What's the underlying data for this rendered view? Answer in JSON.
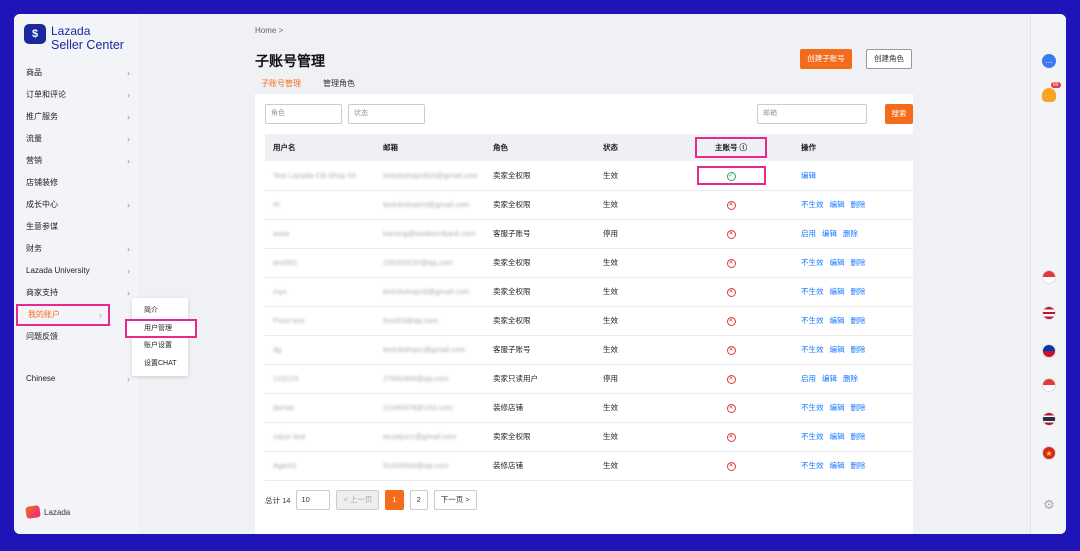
{
  "brand": {
    "name1": "Lazada",
    "name2": "Seller Center",
    "footer": "Lazada"
  },
  "sidebar": {
    "items": [
      {
        "label": "商品",
        "chev": "›"
      },
      {
        "label": "订单和评论",
        "chev": "›"
      },
      {
        "label": "推广服务",
        "chev": "›"
      },
      {
        "label": "流量",
        "chev": "›"
      },
      {
        "label": "营销",
        "chev": "›"
      },
      {
        "label": "店铺装修",
        "chev": ""
      },
      {
        "label": "成长中心",
        "chev": "›"
      },
      {
        "label": "生意参谋",
        "chev": ""
      },
      {
        "label": "财务",
        "chev": "›"
      },
      {
        "label": "Lazada University",
        "chev": "›"
      },
      {
        "label": "商家支持",
        "chev": "›"
      },
      {
        "label": "我的账户",
        "chev": "›"
      },
      {
        "label": "问题反馈",
        "chev": ""
      },
      {
        "label": "Chinese",
        "chev": "›"
      }
    ],
    "submenu": [
      "简介",
      "用户管理",
      "账户设置",
      "设置CHAT"
    ]
  },
  "header": {
    "breadcrumb": "Home  >",
    "title": "子账号管理",
    "create_sub_account": "创建子账号",
    "create_role": "创建角色"
  },
  "tabs": [
    "子账号管理",
    "管理角色"
  ],
  "filters": {
    "role_placeholder": "角色",
    "status_placeholder": "状态",
    "email_placeholder": "邮箱",
    "search": "搜索"
  },
  "table": {
    "headers": [
      "用户名",
      "邮箱",
      "角色",
      "状态",
      "主账号 ⓘ",
      "操作"
    ],
    "rows": [
      {
        "name": "Test Lazada CB Shop 03",
        "email": "testcbshop1803@gmail.com",
        "role": "卖家全权限",
        "status": "生效",
        "main": true,
        "actions": [
          "编辑"
        ]
      },
      {
        "name": "rh",
        "email": "testcbshop03@gmail.com",
        "role": "卖家全权限",
        "status": "生效",
        "main": false,
        "actions": [
          "不生效",
          "编辑",
          "删除"
        ]
      },
      {
        "name": "www",
        "email": "kanong@kasikornbank.com",
        "role": "客服子账号",
        "status": "停用",
        "main": false,
        "actions": [
          "启用",
          "编辑",
          "删除"
        ]
      },
      {
        "name": "test001",
        "email": "235200232@qq.com",
        "role": "卖家全权限",
        "status": "生效",
        "main": false,
        "actions": [
          "不生效",
          "编辑",
          "删除"
        ]
      },
      {
        "name": "mys",
        "email": "testcbshop18@gmail.com",
        "role": "卖家全权限",
        "status": "生效",
        "main": false,
        "actions": [
          "不生效",
          "编辑",
          "删除"
        ]
      },
      {
        "name": "Frost test",
        "email": "frost03@qq.com",
        "role": "卖家全权限",
        "status": "生效",
        "main": false,
        "actions": [
          "不生效",
          "编辑",
          "删除"
        ]
      },
      {
        "name": "dg",
        "email": "testcbshop1@gmail.com",
        "role": "客服子账号",
        "status": "生效",
        "main": false,
        "actions": [
          "不生效",
          "编辑",
          "删除"
        ]
      },
      {
        "name": "123123",
        "email": "27692406@qq.com",
        "role": "卖家只读用户",
        "status": "停用",
        "main": false,
        "actions": [
          "启用",
          "编辑",
          "删除"
        ]
      },
      {
        "name": "damai",
        "email": "12345678@163.com",
        "role": "装修店铺",
        "status": "生效",
        "main": false,
        "actions": [
          "不生效",
          "编辑",
          "删除"
        ]
      },
      {
        "name": "zejun test",
        "email": "wuzejun1@gmail.com",
        "role": "卖家全权限",
        "status": "生效",
        "main": false,
        "actions": [
          "不生效",
          "编辑",
          "删除"
        ]
      },
      {
        "name": "Agent1",
        "email": "51425934@qq.com",
        "role": "装修店铺",
        "status": "生效",
        "main": false,
        "actions": [
          "不生效",
          "编辑",
          "删除"
        ]
      }
    ]
  },
  "pagination": {
    "total": "总计 14",
    "page_size": "10",
    "prev": "< 上一页",
    "pages": [
      "1",
      "2"
    ],
    "next": "下一页 >"
  },
  "rail": {
    "bell_count": "89"
  },
  "colors": {
    "accent": "#f36c1c",
    "highlight": "#e8278f",
    "link": "#1677ff",
    "brand": "#1a2a9c"
  }
}
